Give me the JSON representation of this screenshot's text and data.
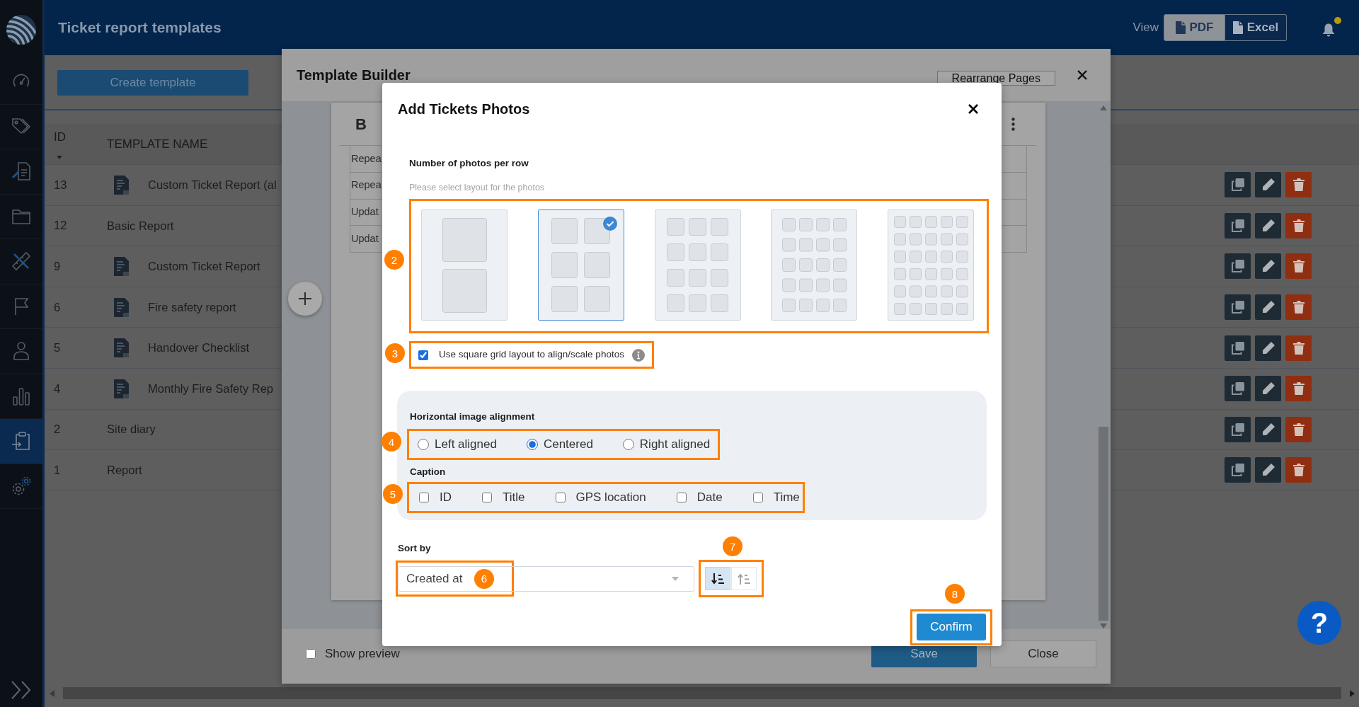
{
  "header": {
    "title": "Ticket report templates",
    "view_label": "View",
    "view_options": [
      {
        "label": "PDF",
        "selected": true
      },
      {
        "label": "Excel",
        "selected": false
      }
    ],
    "unread_dot": true
  },
  "sidebar": {
    "items": [
      {
        "selected": false
      },
      {
        "selected": false
      },
      {
        "selected": false
      },
      {
        "selected": false
      },
      {
        "selected": false
      },
      {
        "selected": false
      },
      {
        "selected": false
      },
      {
        "selected": false
      },
      {
        "selected": true
      },
      {
        "selected": false
      }
    ]
  },
  "toolbar": {
    "create_button": "Create template"
  },
  "table": {
    "columns": [
      {
        "label": "ID",
        "sorted": true
      },
      {
        "label": "TEMPLATE NAME"
      }
    ],
    "rows": [
      {
        "id": "13",
        "name": "Custom Ticket Report (al",
        "has_icon": true
      },
      {
        "id": "12",
        "name": "Basic Report",
        "has_icon": false
      },
      {
        "id": "9",
        "name": "Custom Ticket Report",
        "has_icon": true
      },
      {
        "id": "6",
        "name": "Fire safety report",
        "has_icon": true
      },
      {
        "id": "5",
        "name": "Handover Checklist",
        "has_icon": true
      },
      {
        "id": "4",
        "name": "Monthly Fire Safety Rep",
        "has_icon": true
      },
      {
        "id": "2",
        "name": "Site diary",
        "has_icon": false
      },
      {
        "id": "1",
        "name": "Report",
        "has_icon": false
      }
    ]
  },
  "template_builder": {
    "title": "Template Builder",
    "rearrange_button": "Rearrange Pages",
    "page": {
      "toolbar_label": "B",
      "rows": [
        "Repea",
        "Repea",
        "Updat",
        "Updat"
      ]
    },
    "show_preview": {
      "label": "Show preview",
      "checked": false
    },
    "buttons": [
      {
        "label": "Save",
        "kind": "primary"
      },
      {
        "label": "Close",
        "kind": "secondary"
      }
    ]
  },
  "dialog": {
    "title": "Add Tickets Photos",
    "layout": {
      "label": "Number of photos per row",
      "hint": "Please select layout for the photos",
      "callout": "2",
      "options": [
        {
          "selected": false
        },
        {
          "selected": true
        },
        {
          "selected": false
        },
        {
          "selected": false
        },
        {
          "selected": false
        }
      ]
    },
    "square_grid": {
      "label": "Use square grid layout to align/scale photos",
      "checked": true,
      "callout": "3"
    },
    "alignment": {
      "label": "Horizontal image alignment",
      "callout": "4",
      "options": [
        {
          "label": "Left aligned",
          "selected": false
        },
        {
          "label": "Centered",
          "selected": true
        },
        {
          "label": "Right aligned",
          "selected": false
        }
      ]
    },
    "caption": {
      "label": "Caption",
      "callout": "5",
      "options": [
        {
          "label": "ID",
          "checked": false
        },
        {
          "label": "Title",
          "checked": false
        },
        {
          "label": "GPS location",
          "checked": false
        },
        {
          "label": "Date",
          "checked": false
        },
        {
          "label": "Time",
          "checked": false
        }
      ]
    },
    "sort": {
      "label": "Sort by",
      "value": "Created at",
      "callout": "6",
      "order": {
        "callout": "7",
        "buttons": [
          {
            "kind": "descending",
            "selected": true
          },
          {
            "kind": "ascending",
            "selected": false
          }
        ]
      }
    },
    "confirm": {
      "label": "Confirm",
      "callout": "8"
    }
  },
  "help_button": "?"
}
